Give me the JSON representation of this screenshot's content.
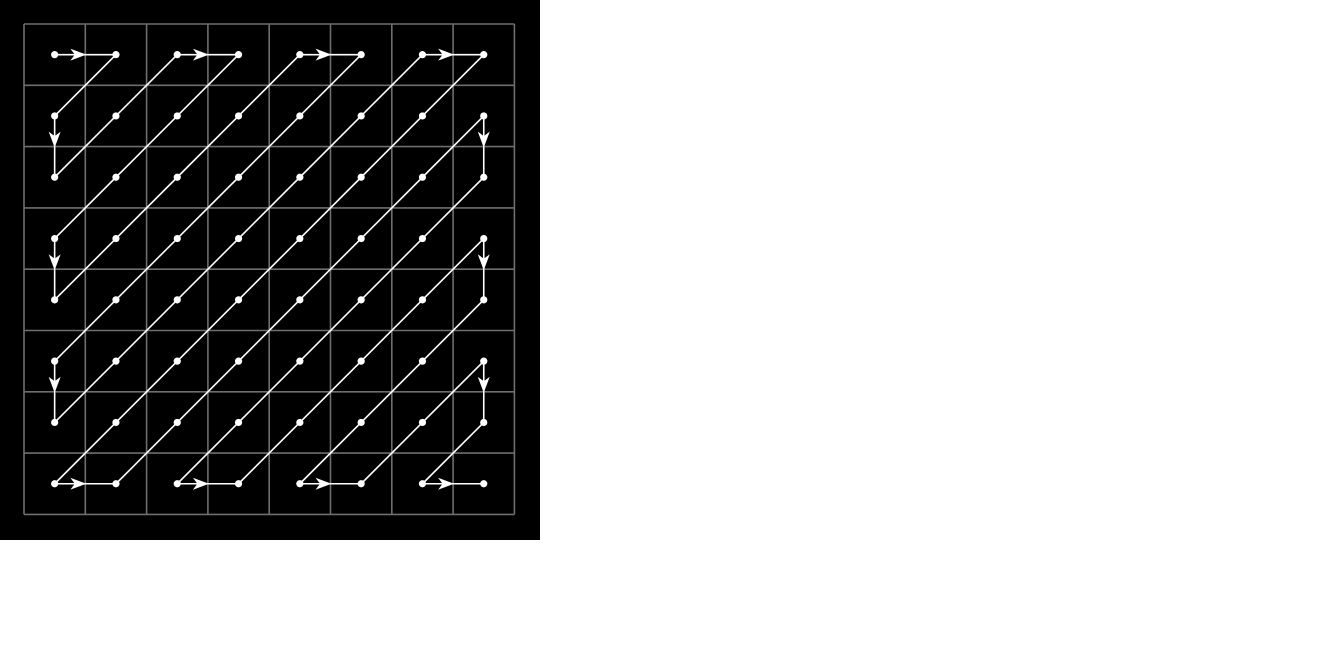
{
  "diagram": {
    "kind": "zigzag-scan-order",
    "grid_cells": 8,
    "background_color": "#000000",
    "grid_color": "#6e6e6e",
    "path_color": "#ffffff",
    "arrow_head_icon": "arrowhead-icon"
  }
}
